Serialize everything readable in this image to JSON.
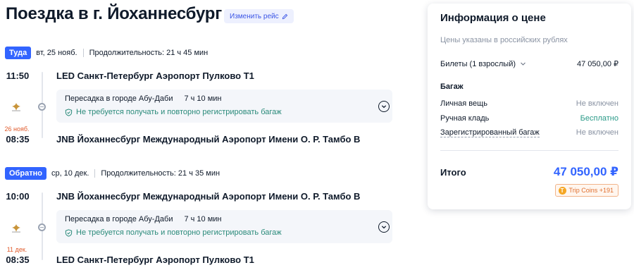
{
  "header": {
    "title": "Поездка в г. Йоханнесбург",
    "change_label": "Изменить рейс"
  },
  "outbound": {
    "tag": "Туда",
    "date": "вт, 25 нояб.",
    "duration": "Продолжительность: 21 ч 45 мин",
    "depart_time": "11:50",
    "depart_airport": "LED Санкт-Петербург Аэропорт Пулково T1",
    "transfer_city": "Пересадка в городе Абу-Даби",
    "transfer_duration": "7 ч 10 мин",
    "transfer_note": "Не требуется получать и повторно регистрировать багаж",
    "arrive_date": "26 нояб.",
    "arrive_time": "08:35",
    "arrive_airport": "JNB Йоханнесбург Международный Аэропорт Имени О. Р. Тамбо B"
  },
  "return": {
    "tag": "Обратно",
    "date": "ср, 10 дек.",
    "duration": "Продолжительность: 21 ч 35 мин",
    "depart_time": "10:00",
    "depart_airport": "JNB Йоханнесбург Международный Аэропорт Имени О. Р. Тамбо B",
    "transfer_city": "Пересадка в городе Абу-Даби",
    "transfer_duration": "7 ч 10 мин",
    "transfer_note": "Не требуется получать и повторно регистрировать багаж",
    "arrive_date": "11 дек.",
    "arrive_time": "08:35",
    "arrive_airport": "LED Санкт-Петербург Аэропорт Пулково T1"
  },
  "price": {
    "title": "Информация о цене",
    "subtitle": "Цены указаны в российских рублях",
    "tickets_label": "Билеты (1 взрослый)",
    "tickets_value": "47 050,00 ₽",
    "baggage_heading": "Багаж",
    "personal_label": "Личная вещь",
    "personal_value": "Не включен",
    "carryon_label": "Ручная кладь",
    "carryon_value": "Бесплатно",
    "checked_label": "Зарегистрированный багаж",
    "checked_value": "Не включен",
    "total_label": "Итого",
    "total_value": "47 050,00 ₽",
    "coins_label": "Trip Coins +191"
  },
  "colors": {
    "accent": "#3264ff",
    "teal": "#2a8a7a",
    "orange": "#e05a2b"
  }
}
